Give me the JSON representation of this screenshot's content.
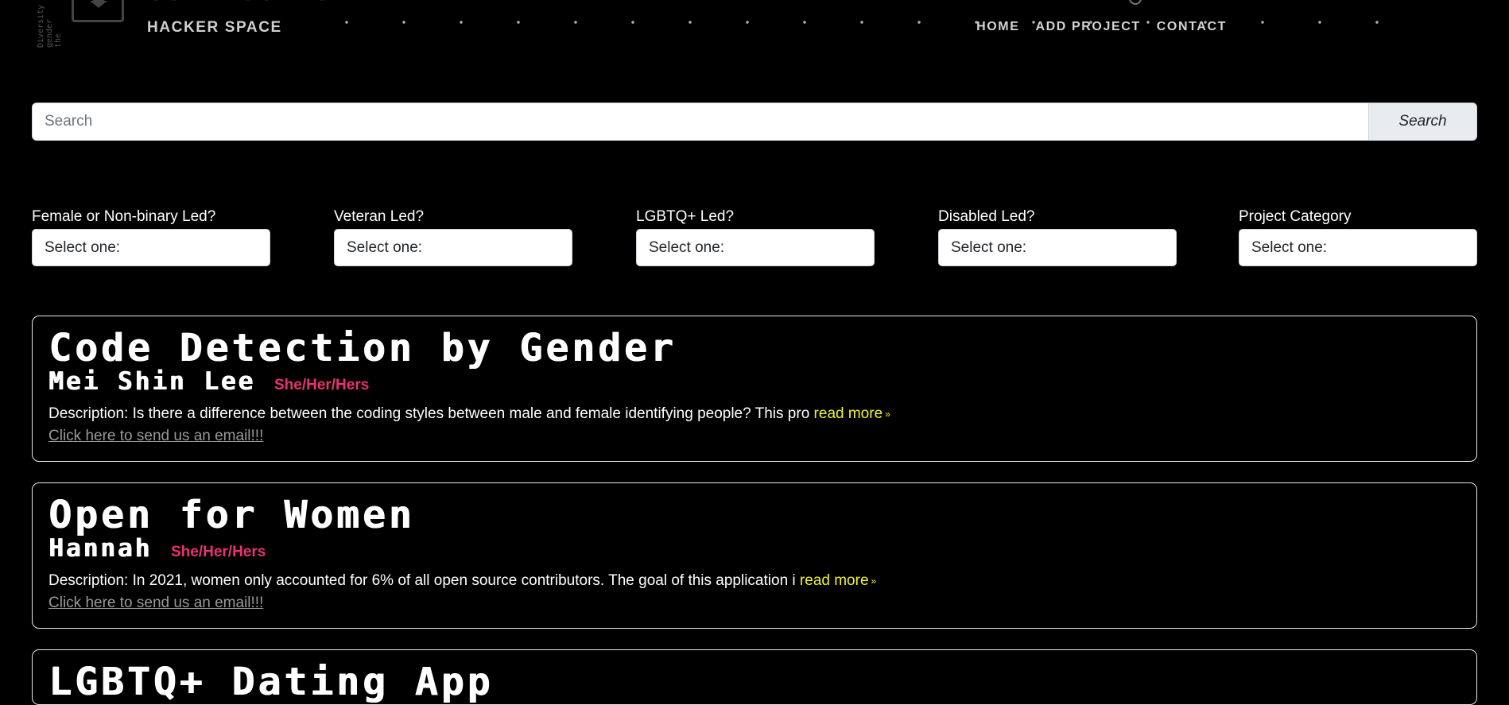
{
  "header": {
    "brand_top": "OUR LOOK UP",
    "brand": "HACKER SPACE",
    "side_text": "Diversity gender the",
    "nav": [
      "HOME",
      "ADD PROJECT",
      "CONTACT"
    ]
  },
  "search": {
    "placeholder": "Search",
    "button_label": "Search"
  },
  "filters": [
    {
      "label": "Female or Non-binary Led?",
      "selected": "Select one:"
    },
    {
      "label": "Veteran Led?",
      "selected": "Select one:"
    },
    {
      "label": "LGBTQ+ Led?",
      "selected": "Select one:"
    },
    {
      "label": "Disabled Led?",
      "selected": "Select one:"
    },
    {
      "label": "Project Category",
      "selected": "Select one:"
    }
  ],
  "projects": [
    {
      "title": "Code Detection by Gender",
      "author": "Mei Shin Lee",
      "pronouns": "She/Her/Hers",
      "description": "Description: Is there a difference between the coding styles between male and female identifying people? This pro",
      "read_more": "read more",
      "email_link": "Click here to send us an email!!!"
    },
    {
      "title": "Open for Women",
      "author": "Hannah",
      "pronouns": "She/Her/Hers",
      "description": "Description: In 2021, women only accounted for 6% of all open source contributors. The goal of this application i",
      "read_more": "read more",
      "email_link": "Click here to send us an email!!!"
    },
    {
      "title": "LGBTQ+ Dating App"
    }
  ],
  "colors": {
    "background": "#000000",
    "pronoun_accent": "#e8336e",
    "read_more_accent": "#f2f230",
    "link_gray": "#9a9a9a"
  }
}
